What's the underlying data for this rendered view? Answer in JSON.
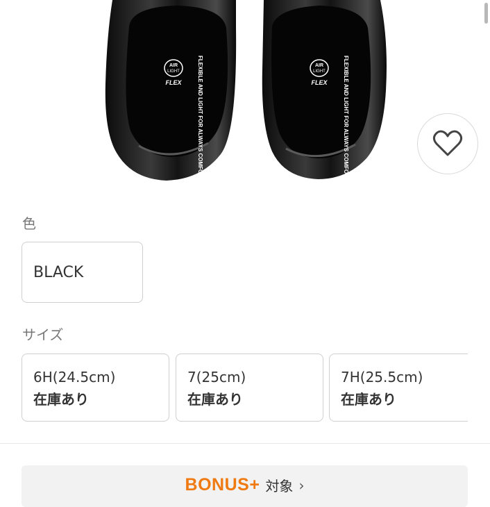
{
  "product": {
    "insole_text": {
      "logo_top": "AIR",
      "logo_mid": "LIGHT",
      "logo_bottom": "FLEX",
      "tagline": "FLEXIBLE AND LIGHT FOR ALWAYS COMFORT."
    },
    "favorite_icon": "heart-icon"
  },
  "color": {
    "label": "色",
    "options": [
      {
        "label": "BLACK"
      }
    ]
  },
  "size": {
    "label": "サイズ",
    "options": [
      {
        "name": "6H(24.5cm)",
        "stock": "在庫あり"
      },
      {
        "name": "7(25cm)",
        "stock": "在庫あり"
      },
      {
        "name": "7H(25.5cm)",
        "stock": "在庫あり"
      }
    ]
  },
  "bonus": {
    "logo": "BONUS+",
    "text": "対象",
    "chevron_icon": "chevron-right-icon",
    "logo_color": "#f07a12"
  }
}
